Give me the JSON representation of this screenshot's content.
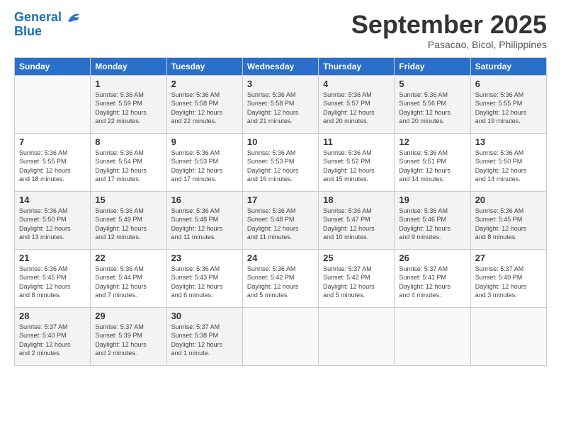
{
  "logo": {
    "line1": "General",
    "line2": "Blue"
  },
  "title": "September 2025",
  "location": "Pasacao, Bicol, Philippines",
  "headers": [
    "Sunday",
    "Monday",
    "Tuesday",
    "Wednesday",
    "Thursday",
    "Friday",
    "Saturday"
  ],
  "weeks": [
    [
      {
        "num": "",
        "info": ""
      },
      {
        "num": "1",
        "info": "Sunrise: 5:36 AM\nSunset: 5:59 PM\nDaylight: 12 hours\nand 22 minutes."
      },
      {
        "num": "2",
        "info": "Sunrise: 5:36 AM\nSunset: 5:58 PM\nDaylight: 12 hours\nand 22 minutes."
      },
      {
        "num": "3",
        "info": "Sunrise: 5:36 AM\nSunset: 5:58 PM\nDaylight: 12 hours\nand 21 minutes."
      },
      {
        "num": "4",
        "info": "Sunrise: 5:36 AM\nSunset: 5:57 PM\nDaylight: 12 hours\nand 20 minutes."
      },
      {
        "num": "5",
        "info": "Sunrise: 5:36 AM\nSunset: 5:56 PM\nDaylight: 12 hours\nand 20 minutes."
      },
      {
        "num": "6",
        "info": "Sunrise: 5:36 AM\nSunset: 5:55 PM\nDaylight: 12 hours\nand 19 minutes."
      }
    ],
    [
      {
        "num": "7",
        "info": "Sunrise: 5:36 AM\nSunset: 5:55 PM\nDaylight: 12 hours\nand 18 minutes."
      },
      {
        "num": "8",
        "info": "Sunrise: 5:36 AM\nSunset: 5:54 PM\nDaylight: 12 hours\nand 17 minutes."
      },
      {
        "num": "9",
        "info": "Sunrise: 5:36 AM\nSunset: 5:53 PM\nDaylight: 12 hours\nand 17 minutes."
      },
      {
        "num": "10",
        "info": "Sunrise: 5:36 AM\nSunset: 5:53 PM\nDaylight: 12 hours\nand 16 minutes."
      },
      {
        "num": "11",
        "info": "Sunrise: 5:36 AM\nSunset: 5:52 PM\nDaylight: 12 hours\nand 15 minutes."
      },
      {
        "num": "12",
        "info": "Sunrise: 5:36 AM\nSunset: 5:51 PM\nDaylight: 12 hours\nand 14 minutes."
      },
      {
        "num": "13",
        "info": "Sunrise: 5:36 AM\nSunset: 5:50 PM\nDaylight: 12 hours\nand 14 minutes."
      }
    ],
    [
      {
        "num": "14",
        "info": "Sunrise: 5:36 AM\nSunset: 5:50 PM\nDaylight: 12 hours\nand 13 minutes."
      },
      {
        "num": "15",
        "info": "Sunrise: 5:36 AM\nSunset: 5:49 PM\nDaylight: 12 hours\nand 12 minutes."
      },
      {
        "num": "16",
        "info": "Sunrise: 5:36 AM\nSunset: 5:48 PM\nDaylight: 12 hours\nand 11 minutes."
      },
      {
        "num": "17",
        "info": "Sunrise: 5:36 AM\nSunset: 5:48 PM\nDaylight: 12 hours\nand 11 minutes."
      },
      {
        "num": "18",
        "info": "Sunrise: 5:36 AM\nSunset: 5:47 PM\nDaylight: 12 hours\nand 10 minutes."
      },
      {
        "num": "19",
        "info": "Sunrise: 5:36 AM\nSunset: 5:46 PM\nDaylight: 12 hours\nand 9 minutes."
      },
      {
        "num": "20",
        "info": "Sunrise: 5:36 AM\nSunset: 5:45 PM\nDaylight: 12 hours\nand 8 minutes."
      }
    ],
    [
      {
        "num": "21",
        "info": "Sunrise: 5:36 AM\nSunset: 5:45 PM\nDaylight: 12 hours\nand 8 minutes."
      },
      {
        "num": "22",
        "info": "Sunrise: 5:36 AM\nSunset: 5:44 PM\nDaylight: 12 hours\nand 7 minutes."
      },
      {
        "num": "23",
        "info": "Sunrise: 5:36 AM\nSunset: 5:43 PM\nDaylight: 12 hours\nand 6 minutes."
      },
      {
        "num": "24",
        "info": "Sunrise: 5:36 AM\nSunset: 5:42 PM\nDaylight: 12 hours\nand 5 minutes."
      },
      {
        "num": "25",
        "info": "Sunrise: 5:37 AM\nSunset: 5:42 PM\nDaylight: 12 hours\nand 5 minutes."
      },
      {
        "num": "26",
        "info": "Sunrise: 5:37 AM\nSunset: 5:41 PM\nDaylight: 12 hours\nand 4 minutes."
      },
      {
        "num": "27",
        "info": "Sunrise: 5:37 AM\nSunset: 5:40 PM\nDaylight: 12 hours\nand 3 minutes."
      }
    ],
    [
      {
        "num": "28",
        "info": "Sunrise: 5:37 AM\nSunset: 5:40 PM\nDaylight: 12 hours\nand 2 minutes."
      },
      {
        "num": "29",
        "info": "Sunrise: 5:37 AM\nSunset: 5:39 PM\nDaylight: 12 hours\nand 2 minutes."
      },
      {
        "num": "30",
        "info": "Sunrise: 5:37 AM\nSunset: 5:38 PM\nDaylight: 12 hours\nand 1 minute."
      },
      {
        "num": "",
        "info": ""
      },
      {
        "num": "",
        "info": ""
      },
      {
        "num": "",
        "info": ""
      },
      {
        "num": "",
        "info": ""
      }
    ]
  ]
}
